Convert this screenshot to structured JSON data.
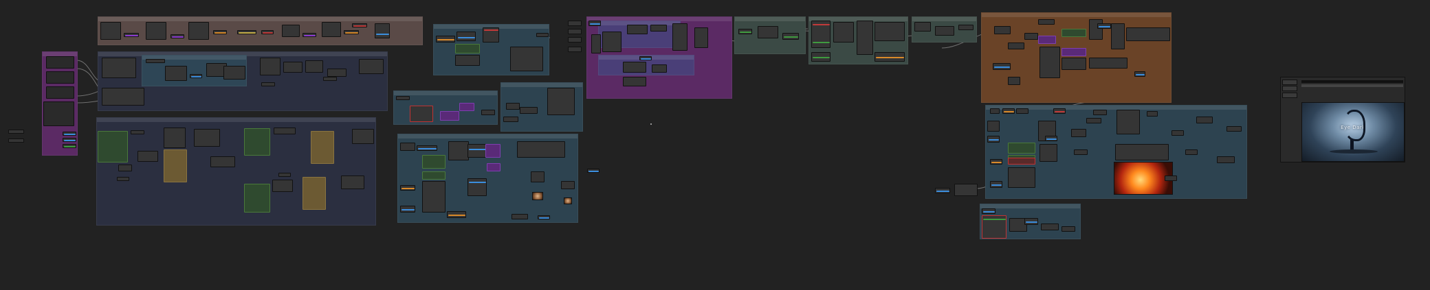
{
  "app": {
    "name": ""
  },
  "canvas": {
    "background": "#222222",
    "preview_caption": "Eye Dark"
  },
  "colors": {
    "group_purple": "#5b2a64",
    "group_brown": "#5a4a47",
    "group_navy": "#2b2f40",
    "group_teal": "#2d4350",
    "group_orange": "#6a4327",
    "group_sage": "#3b4a45",
    "link": "#8c8c8c",
    "widget_blue": "#3b8ede",
    "widget_purple": "#8d3bd0",
    "widget_orange": "#d98a2a",
    "widget_red": "#c23a3a",
    "widget_green": "#3f9b3f"
  },
  "icons": {
    "image_preview_main": "image-preview-icon",
    "image_preview_fire": "image-preview-icon"
  }
}
